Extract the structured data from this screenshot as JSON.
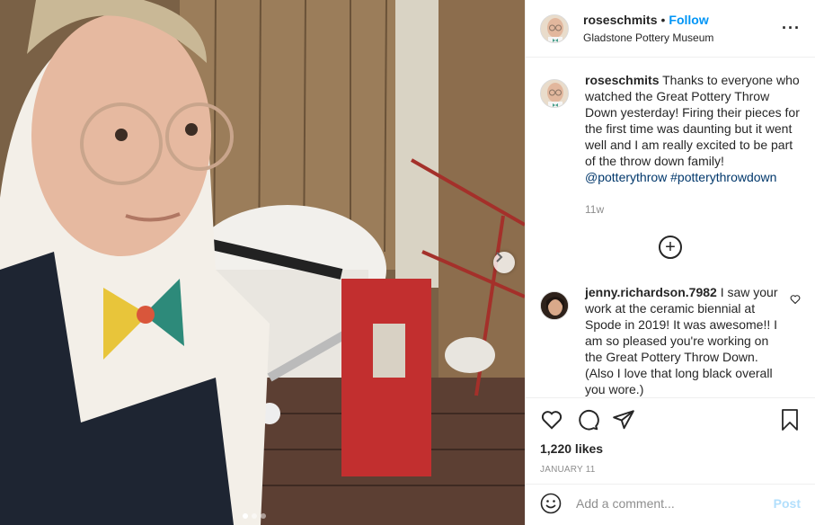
{
  "photo": {
    "description_icon": "photo",
    "next_icon": "chevron-right-icon",
    "carousel": {
      "count": 3,
      "active": 1
    }
  },
  "header": {
    "username": "roseschmits",
    "separator": "•",
    "follow_label": "Follow",
    "location": "Gladstone Pottery Museum",
    "more_icon": "more-horizontal-icon",
    "more_label": "···"
  },
  "caption": {
    "username": "roseschmits",
    "text": "Thanks to everyone who watched the Great Pottery Throw Down yesterday! Firing their pieces for the first time was daunting but it went well and I am really excited to be part of the throw down family!",
    "mention": "@potterythrow",
    "hashtag": "#potterythrowdown",
    "time": "11w"
  },
  "load_more_label": "+",
  "comments": [
    {
      "username": "jenny.richardson.7982",
      "text": "I saw your work at the ceramic biennial at Spode in 2019! It was awesome!! I am so pleased you're working on the Great Pottery Throw Down. (Also I love that long black overall you wore.)"
    }
  ],
  "actions": {
    "likes": "1,220 likes",
    "date": "JANUARY 11"
  },
  "composer": {
    "placeholder": "Add a comment...",
    "post_label": "Post"
  },
  "colors": {
    "accent": "#0095f6",
    "post_disabled": "#b2dffc",
    "hashtag": "#00376b",
    "muted": "#8e8e8e"
  }
}
